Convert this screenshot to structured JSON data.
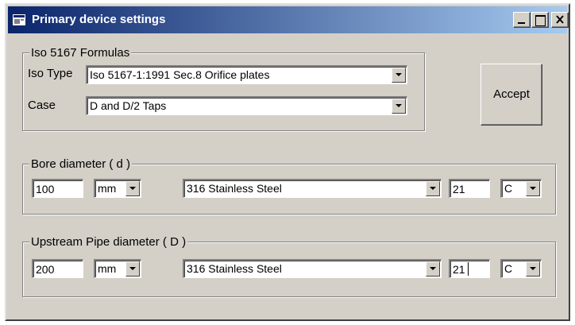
{
  "window": {
    "title": "Primary device settings",
    "icon": "app-icon",
    "controls": [
      "minimize-icon",
      "maximize-icon",
      "close-icon"
    ]
  },
  "formulas": {
    "group_label": "Iso 5167 Formulas",
    "iso_type_label": "Iso Type",
    "iso_type_value": "Iso 5167-1:1991 Sec.8 Orifice plates",
    "case_label": "Case",
    "case_value": "D and D/2 Taps"
  },
  "accept_label": "Accept",
  "bore": {
    "group_label": "Bore diameter ( d )",
    "value": "100",
    "unit": "mm",
    "material": "316 Stainless Steel",
    "temperature": "21",
    "temp_unit": "C"
  },
  "upstream": {
    "group_label": "Upstream Pipe diameter ( D )",
    "value": "200",
    "unit": "mm",
    "material": "316 Stainless Steel",
    "temperature": "21",
    "temp_unit": "C"
  },
  "colors": {
    "titlebar_start": "#0a246a",
    "titlebar_end": "#a6caf0",
    "face": "#d4d0c8"
  }
}
